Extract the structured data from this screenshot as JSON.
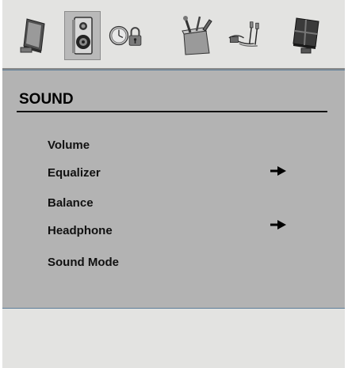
{
  "icon_bar": {
    "tabs": [
      {
        "icon": "picture-icon",
        "selected": false
      },
      {
        "icon": "speaker-icon",
        "selected": true
      },
      {
        "icon": "clock-lock-icon",
        "selected": false
      },
      {
        "icon": "tools-icon",
        "selected": false
      },
      {
        "icon": "connector-cable-icon",
        "selected": false
      },
      {
        "icon": "monitor-icon",
        "selected": false
      }
    ]
  },
  "panel": {
    "title": "SOUND",
    "items": [
      {
        "label": "Volume",
        "has_submenu": false
      },
      {
        "label": "Equalizer",
        "has_submenu": true
      },
      {
        "label": "Balance",
        "has_submenu": false
      },
      {
        "label": "Headphone",
        "has_submenu": true
      },
      {
        "label": "Sound Mode",
        "has_submenu": false
      }
    ]
  },
  "colors": {
    "background": "#e3e3e1",
    "panel": "#b3b3b3",
    "panel_border": "#5d7e99",
    "selected_tab": "#b9b9b9"
  }
}
